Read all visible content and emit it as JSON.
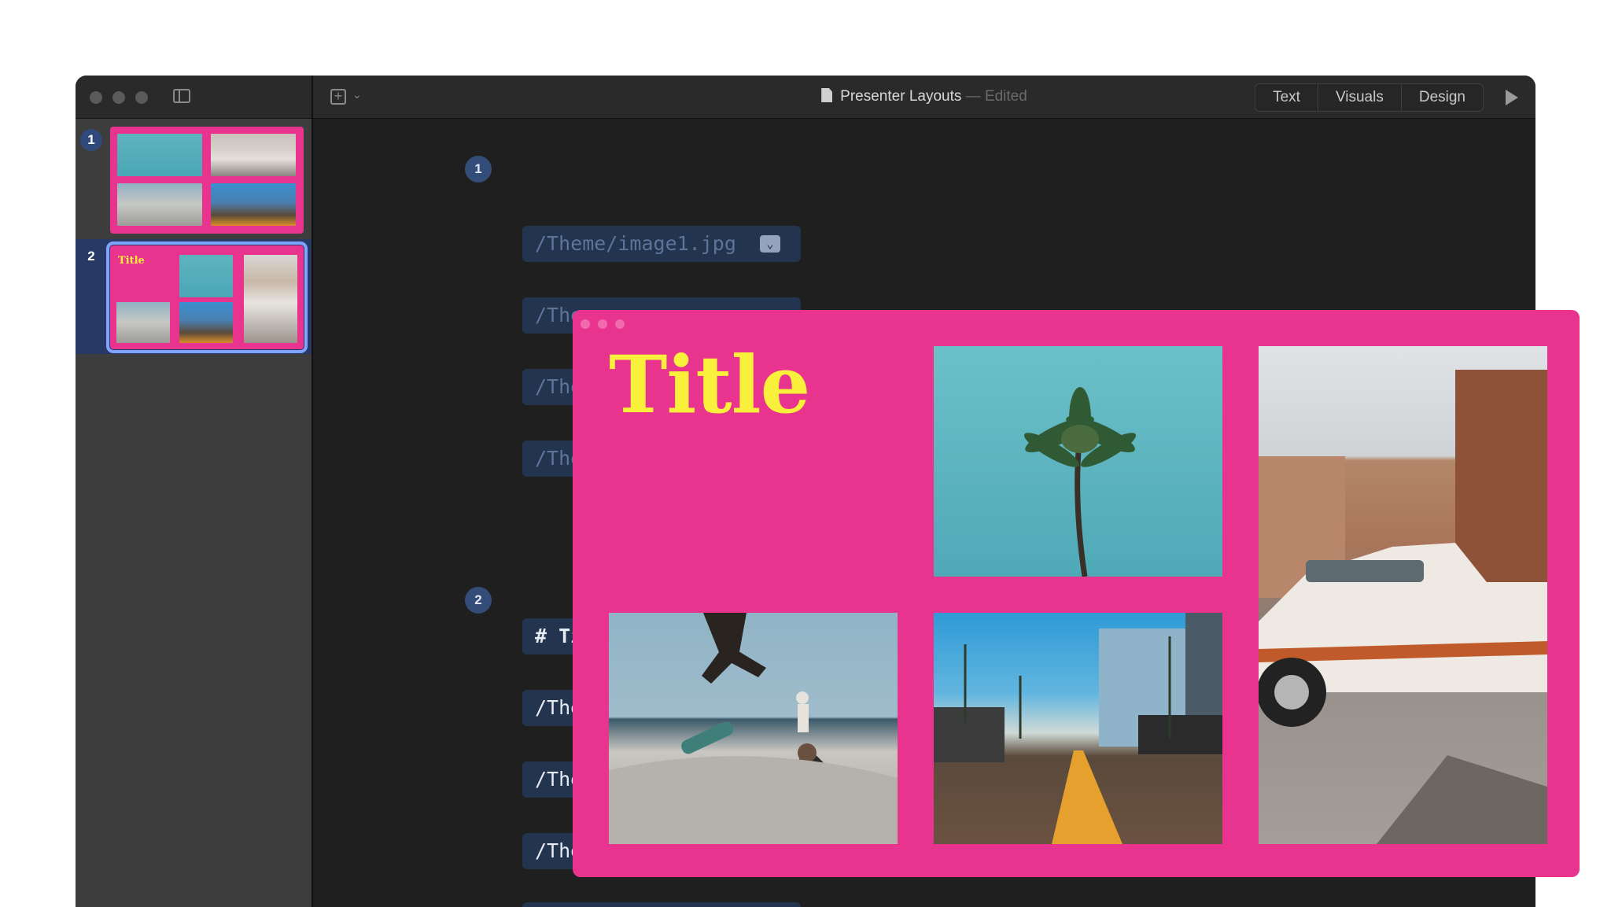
{
  "window": {
    "document_title": "Presenter Layouts",
    "separator": "—",
    "status": "Edited"
  },
  "toolbar": {
    "segments": [
      "Text",
      "Visuals",
      "Design"
    ]
  },
  "slides": [
    {
      "number": "1"
    },
    {
      "number": "2",
      "title": "Title"
    }
  ],
  "editor": {
    "markers": [
      "1",
      "2"
    ],
    "slide1_images": [
      "/Theme/image1.jpg",
      "/The",
      "/The",
      "/The"
    ],
    "separator": "---",
    "slide2_lines": [
      "# Ti",
      "/The",
      "/The",
      "/The"
    ]
  },
  "preview": {
    "title": "Title"
  },
  "icons": [
    "sidebar-toggle-icon",
    "add-slide-icon",
    "chevron-down-icon",
    "document-icon",
    "play-icon"
  ],
  "colors": {
    "slide_background": "#e8348f",
    "title_color": "#f8f03a",
    "selection": "#7fa3ff",
    "editor_background": "#1f1f1f"
  }
}
